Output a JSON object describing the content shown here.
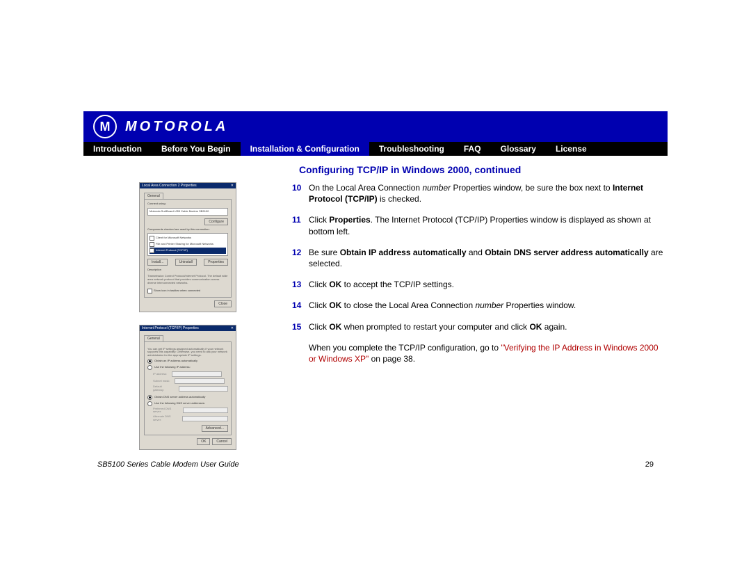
{
  "brand": "MOTOROLA",
  "nav": {
    "items": [
      "Introduction",
      "Before You Begin",
      "Installation & Configuration",
      "Troubleshooting",
      "FAQ",
      "Glossary",
      "License"
    ],
    "active_index": 2
  },
  "section_title": "Configuring TCP/IP in Windows 2000, continued",
  "thumbs": {
    "lan_props": {
      "title": "Local Area Connection 2 Properties",
      "tab": "General",
      "connect_using_label": "Connect using:",
      "adapter": "Motorola SurfBoard USB Cable Modem SB5100",
      "configure_btn": "Configure",
      "components_label": "Components checked are used by this connection:",
      "items": [
        {
          "checked": true,
          "label": "Client for Microsoft Networks"
        },
        {
          "checked": true,
          "label": "File and Printer Sharing for Microsoft Networks"
        },
        {
          "checked": true,
          "label": "Internet Protocol (TCP/IP)",
          "selected": true
        }
      ],
      "btn_install": "Install...",
      "btn_uninstall": "Uninstall",
      "btn_properties": "Properties",
      "description_label": "Description",
      "description_text": "Transmission Control Protocol/Internet Protocol. The default wide area network protocol that provides communication across diverse interconnected networks.",
      "show_icon_label": "Show icon in taskbar when connected",
      "close_btn": "Close"
    },
    "tcpip_props": {
      "title": "Internet Protocol (TCP/IP) Properties",
      "tab": "General",
      "blurb": "You can get IP settings assigned automatically if your network supports this capability. Otherwise, you need to ask your network administrator for the appropriate IP settings.",
      "opt_obtain_ip": "Obtain an IP address automatically",
      "opt_use_ip": "Use the following IP address:",
      "ip_label": "IP address:",
      "subnet_label": "Subnet mask:",
      "gateway_label": "Default gateway:",
      "opt_obtain_dns": "Obtain DNS server address automatically",
      "opt_use_dns": "Use the following DNS server addresses:",
      "pref_dns": "Preferred DNS server:",
      "alt_dns": "Alternate DNS server:",
      "advanced_btn": "Advanced...",
      "ok_btn": "OK",
      "cancel_btn": "Cancel"
    }
  },
  "steps": [
    {
      "num": "10",
      "pre": "On the Local Area Connection ",
      "italic": "number",
      "mid": " Properties window, be sure the box next to ",
      "bold": "Internet Protocol (TCP/IP)",
      "post": " is checked."
    },
    {
      "num": "11",
      "pre": "Click ",
      "bold": "Properties",
      "post": ". The Internet Protocol (TCP/IP) Properties window is displayed as shown at bottom left."
    },
    {
      "num": "12",
      "pre": "Be sure ",
      "bold": "Obtain IP address automatically",
      "mid": " and ",
      "bold2": "Obtain DNS server address automatically",
      "post": " are selected."
    },
    {
      "num": "13",
      "pre": "Click ",
      "bold": "OK",
      "post": " to accept the TCP/IP settings."
    },
    {
      "num": "14",
      "pre": "Click ",
      "bold": "OK",
      "mid": " to close the Local Area Connection ",
      "italic": "number",
      "post": " Properties window."
    },
    {
      "num": "15",
      "pre": "Click ",
      "bold": "OK",
      "mid": " when prompted to restart your computer and click ",
      "bold2": "OK",
      "post": " again."
    }
  ],
  "closing": {
    "pre": "When you complete the TCP/IP configuration, go to ",
    "link": "\"Verifying the IP Address in Windows 2000 or Windows XP\"",
    "post": " on page 38."
  },
  "footer": {
    "guide": "SB5100 Series Cable Modem User Guide",
    "page": "29"
  }
}
